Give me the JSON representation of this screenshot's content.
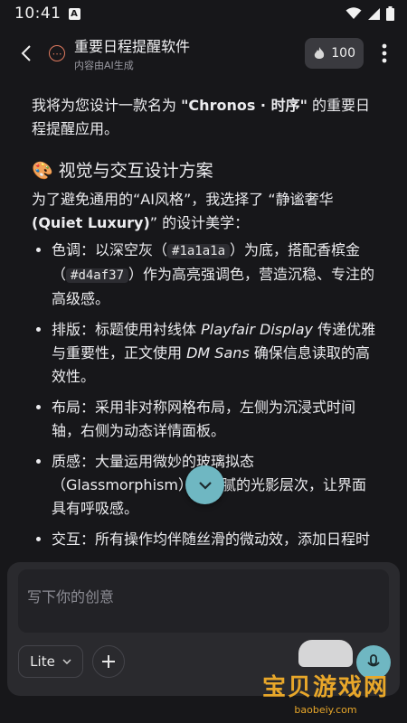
{
  "status": {
    "time": "10:41",
    "notif_glyph": "A"
  },
  "header": {
    "title": "重要日程提醒软件",
    "subtitle": "内容由AI生成",
    "credits": "100"
  },
  "content": {
    "intro": {
      "before": "我将为您设计一款名为 ",
      "name": "\"Chronos · 时序\"",
      "after": " 的重要日程提醒应用。"
    },
    "section_emoji": "🎨",
    "section_title": "视觉与交互设计方案",
    "section_intro": {
      "before": "为了避免通用的“AI风格”，我选择了 “静谧奢华 ",
      "bold": "(Quiet Luxury)",
      "after": "” 的设计美学："
    },
    "bullets": {
      "color": {
        "a": "色调：以深空灰（",
        "code1": "#1a1a1a",
        "b": "）为底，搭配香槟金（",
        "code2": "#d4af37",
        "c": "）作为高亮强调色，营造沉稳、专注的高级感。"
      },
      "type": {
        "a": "排版：标题使用衬线体 ",
        "font1": "Playfair Display",
        "b": " 传递优雅与重要性，正文使用 ",
        "font2": "DM Sans",
        "c": " 确保信息读取的高效性。"
      },
      "layout": "布局：采用非对称网格布局，左侧为沉浸式时间轴，右侧为动态详情面板。",
      "texture": "质感：大量运用微妙的玻璃拟态（Glassmorphism）和细腻的光影层次，让界面具有呼吸感。",
      "interaction": "交互：所有操作均伴随丝滑的微动效，添加日程时会有优雅的展开动画。"
    }
  },
  "composer": {
    "placeholder": "写下你的创意",
    "model": "Lite"
  },
  "watermark": {
    "text": "宝贝游戏网",
    "url": "baobeiy.com"
  },
  "colors": {
    "accent": "#6fb7c2",
    "background": "#17171a",
    "badge": "#3a3a3f"
  }
}
